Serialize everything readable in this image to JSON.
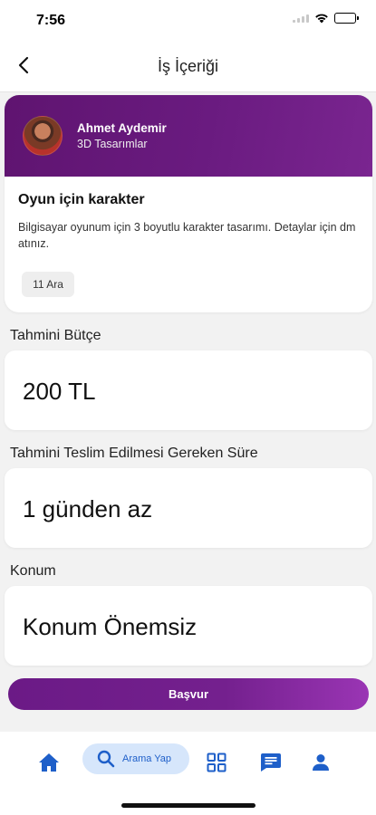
{
  "status_bar": {
    "time": "7:56"
  },
  "nav": {
    "title": "İş İçeriği"
  },
  "job": {
    "user_name": "Ahmet Aydemir",
    "user_role": "3D Tasarımlar",
    "title": "Oyun için karakter",
    "description": "Bilgisayar oyunum için 3 boyutlu karakter tasarımı. Detaylar için dm atınız.",
    "date": "11 Ara",
    "header_colors": [
      "#5f1470",
      "#7a2590"
    ]
  },
  "details": {
    "budget_label": "Tahmini Bütçe",
    "budget_value": "200 TL",
    "duration_label": "Tahmini Teslim Edilmesi Gereken Süre",
    "duration_value": "1 günden az",
    "location_label": "Konum",
    "location_value": "Konum Önemsiz"
  },
  "apply_button": {
    "label": "Başvur",
    "colors": [
      "#6b1a86",
      "#9a35b4"
    ]
  },
  "bottom_nav": {
    "search_label": "Arama Yap",
    "accent_color": "#1e5fc9",
    "items": [
      "home-icon",
      "search-icon",
      "grid-icon",
      "chat-icon",
      "person-icon"
    ]
  }
}
